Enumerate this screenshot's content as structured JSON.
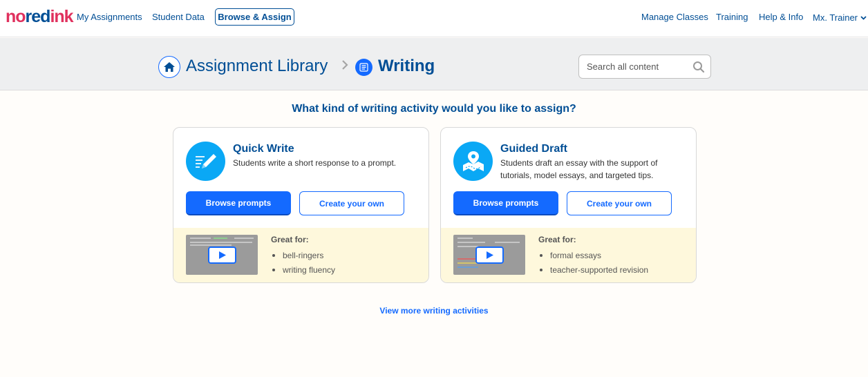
{
  "nav": {
    "logo": {
      "part1": "no",
      "part2": "red",
      "part3": "ink"
    },
    "my_assignments": "My Assignments",
    "student_data": "Student Data",
    "browse_assign": "Browse & Assign",
    "manage_classes": "Manage Classes",
    "training": "Training",
    "help_info": "Help & Info",
    "user": "Mx. Trainer"
  },
  "breadcrumb": {
    "library": "Assignment Library",
    "current": "Writing"
  },
  "search": {
    "placeholder": "Search all content"
  },
  "prompt": "What kind of writing activity would you like to assign?",
  "cards": [
    {
      "title": "Quick Write",
      "description": "Students write a short response to a prompt.",
      "primary": "Browse prompts",
      "secondary": "Create your own",
      "great_for_label": "Great for:",
      "great_for": [
        "bell-ringers",
        "writing fluency"
      ]
    },
    {
      "title": "Guided Draft",
      "description": "Students draft an essay with the support of tutorials, model essays, and targeted tips.",
      "primary": "Browse prompts",
      "secondary": "Create your own",
      "great_for_label": "Great for:",
      "great_for": [
        "formal essays",
        "teacher-supported revision"
      ]
    }
  ],
  "view_more": "View more writing activities",
  "colors": {
    "brand_pink": "#e0315e",
    "navy": "#004e95",
    "primary_blue": "#146aff",
    "icon_cyan": "#0aa8f5",
    "foot_yellow": "#fef8dc"
  },
  "icons": {
    "home": "home-icon",
    "writing": "writing-list-icon",
    "search": "search-icon",
    "quick_write": "pencil-lines-icon",
    "guided_draft": "map-pin-icon",
    "play": "play-icon"
  }
}
